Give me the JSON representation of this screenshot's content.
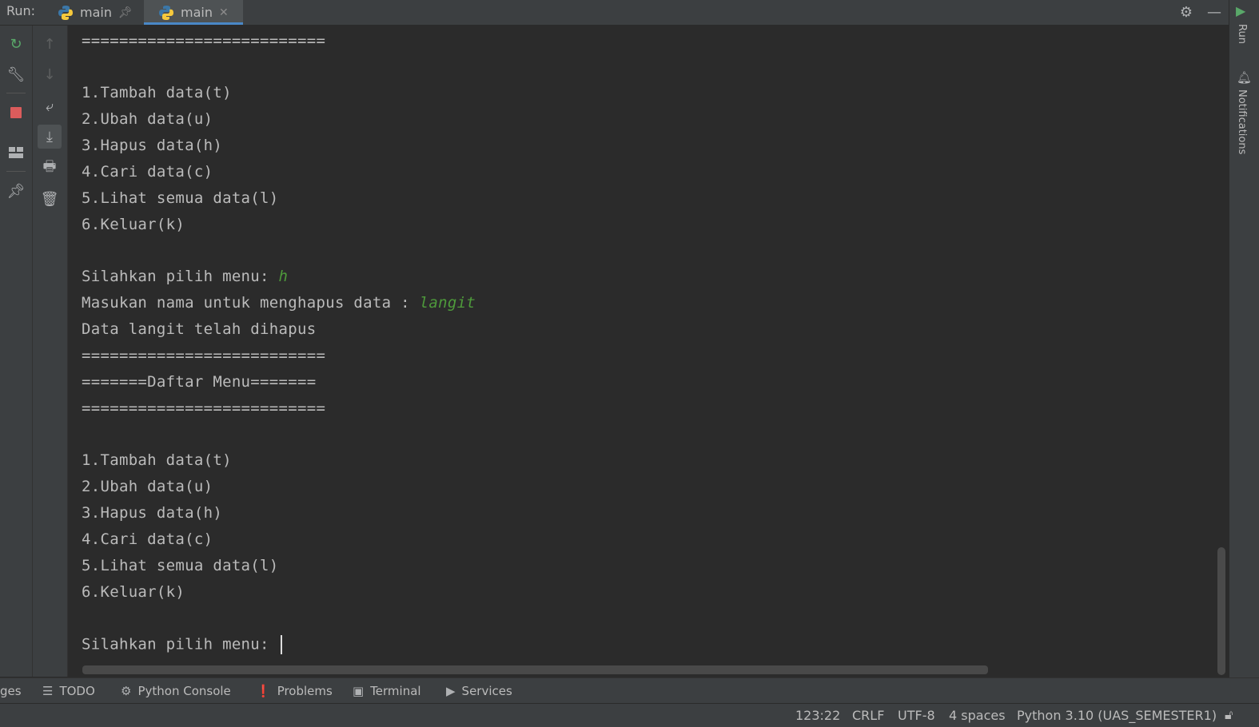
{
  "run_panel": {
    "label": "Run:",
    "tabs": [
      {
        "label": "main",
        "pinned": true
      },
      {
        "label": "main",
        "active": true
      }
    ]
  },
  "right_strip": {
    "run_label": "Run",
    "notifications_label": "Notifications"
  },
  "console": {
    "lines": [
      {
        "text": "=========================="
      },
      {
        "text": ""
      },
      {
        "text": "1.Tambah data(t)"
      },
      {
        "text": "2.Ubah data(u)"
      },
      {
        "text": "3.Hapus data(h)"
      },
      {
        "text": "4.Cari data(c)"
      },
      {
        "text": "5.Lihat semua data(l)"
      },
      {
        "text": "6.Keluar(k)"
      },
      {
        "text": ""
      },
      {
        "text": "Silahkan pilih menu: ",
        "input": "h"
      },
      {
        "text": "Masukan nama untuk menghapus data : ",
        "input": "langit"
      },
      {
        "text": "Data langit telah dihapus"
      },
      {
        "text": "=========================="
      },
      {
        "text": "=======Daftar Menu======="
      },
      {
        "text": "=========================="
      },
      {
        "text": ""
      },
      {
        "text": "1.Tambah data(t)"
      },
      {
        "text": "2.Ubah data(u)"
      },
      {
        "text": "3.Hapus data(h)"
      },
      {
        "text": "4.Cari data(c)"
      },
      {
        "text": "5.Lihat semua data(l)"
      },
      {
        "text": "6.Keluar(k)"
      },
      {
        "text": ""
      },
      {
        "text": "Silahkan pilih menu: ",
        "cursor": true
      }
    ],
    "input_color": "#4e9a3b"
  },
  "bottom_tools": [
    {
      "label": "ges",
      "icon": "none"
    },
    {
      "label": "TODO",
      "icon": "list-icon"
    },
    {
      "label": "Python Console",
      "icon": "python-console-icon"
    },
    {
      "label": "Problems",
      "icon": "problems-icon"
    },
    {
      "label": "Terminal",
      "icon": "terminal-icon"
    },
    {
      "label": "Services",
      "icon": "services-icon"
    }
  ],
  "status_bar": {
    "position": "123:22",
    "line_separator": "CRLF",
    "encoding": "UTF-8",
    "indent": "4 spaces",
    "interpreter": "Python 3.10 (UAS_SEMESTER1)"
  }
}
